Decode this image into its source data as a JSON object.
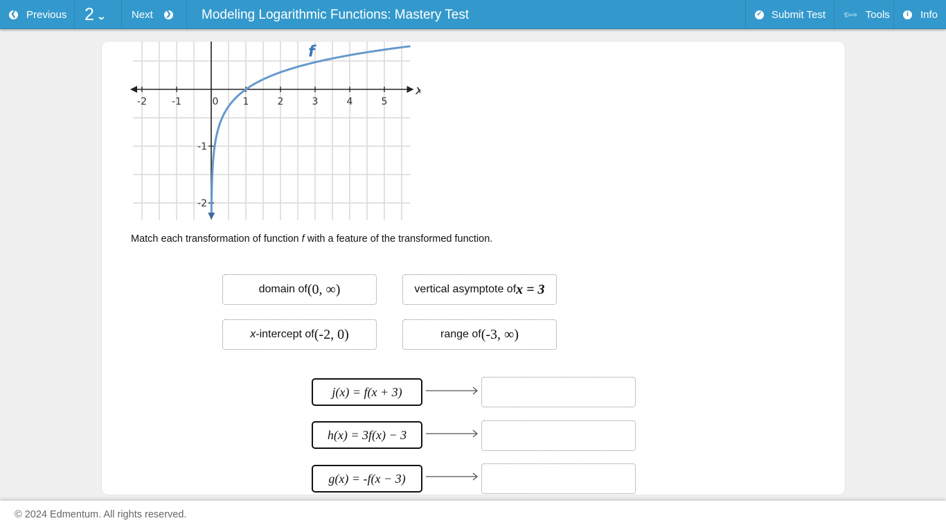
{
  "topbar": {
    "previous_label": "Previous",
    "question_number": "2",
    "next_label": "Next",
    "title": "Modeling Logarithmic Functions: Mastery Test",
    "submit_label": "Submit Test",
    "tools_label": "Tools",
    "info_label": "Info",
    "icons": {
      "previous": "circle-arrow-left-icon",
      "question_dropdown": "chevron-down-icon",
      "next": "circle-arrow-right-icon",
      "submit": "circle-check-icon",
      "tools": "wrench-icon",
      "info": "circle-info-icon"
    }
  },
  "graph": {
    "function_label": "f",
    "x_axis_label": "x",
    "x_tick_labels": [
      "-2",
      "-1",
      "0",
      "1",
      "2",
      "3",
      "4",
      "5"
    ],
    "y_tick_labels": [
      "-1",
      "-2"
    ],
    "x_range": [
      -2.2,
      5.75
    ],
    "y_range": [
      -2.3,
      0.85
    ],
    "curve": "log10(x)",
    "curve_color": "#6699cc"
  },
  "question": {
    "prompt_before": "Match each transformation of function ",
    "prompt_var": "f",
    "prompt_after": " with a feature of the transformed function."
  },
  "tiles": [
    {
      "text": "domain of ",
      "math": "(0, ∞)"
    },
    {
      "text": "vertical asymptote of ",
      "math": "x = 3"
    },
    {
      "italic_prefix": "x",
      "text": "-intercept of ",
      "math": "(-2, 0)"
    },
    {
      "text": "range of ",
      "math": "(-3, ∞)"
    }
  ],
  "transformations": [
    {
      "expression": "j(x) = f(x + 3)",
      "answer": ""
    },
    {
      "expression": "h(x) = 3f(x) − 3",
      "answer": ""
    },
    {
      "expression": "g(x) = -f(x − 3)",
      "answer": ""
    }
  ],
  "footer": {
    "copyright": "© 2024 Edmentum. All rights reserved."
  }
}
